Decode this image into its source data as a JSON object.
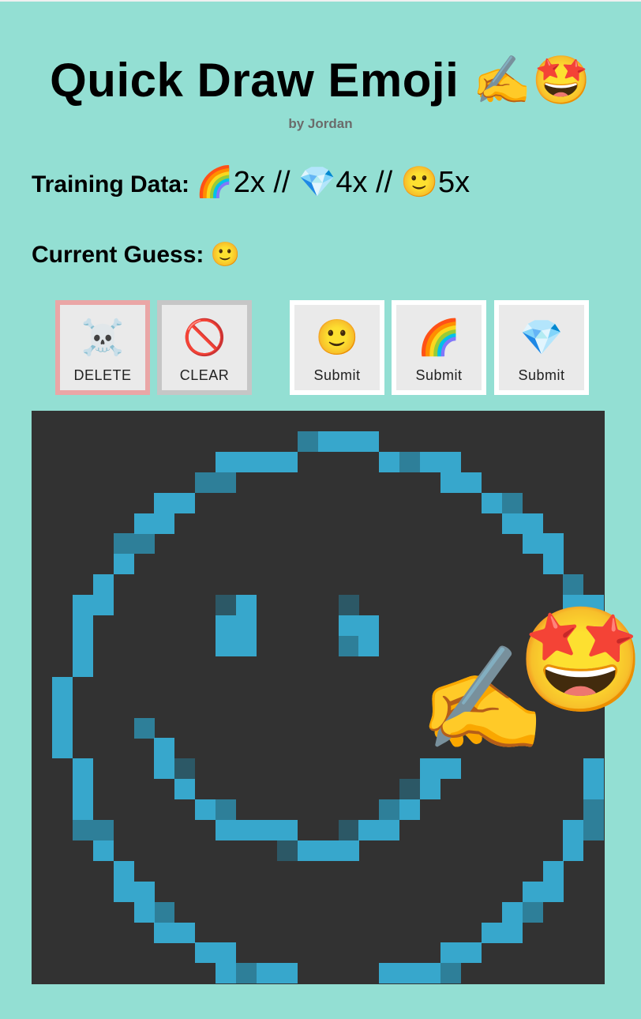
{
  "header": {
    "title": "Quick Draw Emoji ✍️🤩",
    "byline": "by Jordan"
  },
  "training": {
    "label": "Training Data:",
    "summary": "🌈2x // 💎4x // 🙂5x"
  },
  "guess": {
    "label": "Current Guess:",
    "value": "🙂"
  },
  "buttons": [
    {
      "icon": "☠️",
      "label": "DELETE",
      "icon_name": "skull-crossbones-icon"
    },
    {
      "icon": "🚫",
      "label": "CLEAR",
      "icon_name": "prohibited-icon"
    },
    {
      "icon": "🙂",
      "label": "Submit",
      "icon_name": "slightly-smiling-face-icon"
    },
    {
      "icon": "🌈",
      "label": "Submit",
      "icon_name": "rainbow-icon"
    },
    {
      "icon": "💎",
      "label": "Submit",
      "icon_name": "gem-stone-icon"
    }
  ],
  "decoration": {
    "hand": "✍️",
    "star_face": "🤩"
  },
  "colors": {
    "background": "#93dfd3",
    "canvas": "#323232",
    "pixel_bright": "#37a7cc",
    "pixel_mid": "#2e7f99",
    "pixel_dark": "#2c5866",
    "delete_border": "#eaa6a6",
    "clear_border": "#c6c6c6"
  }
}
